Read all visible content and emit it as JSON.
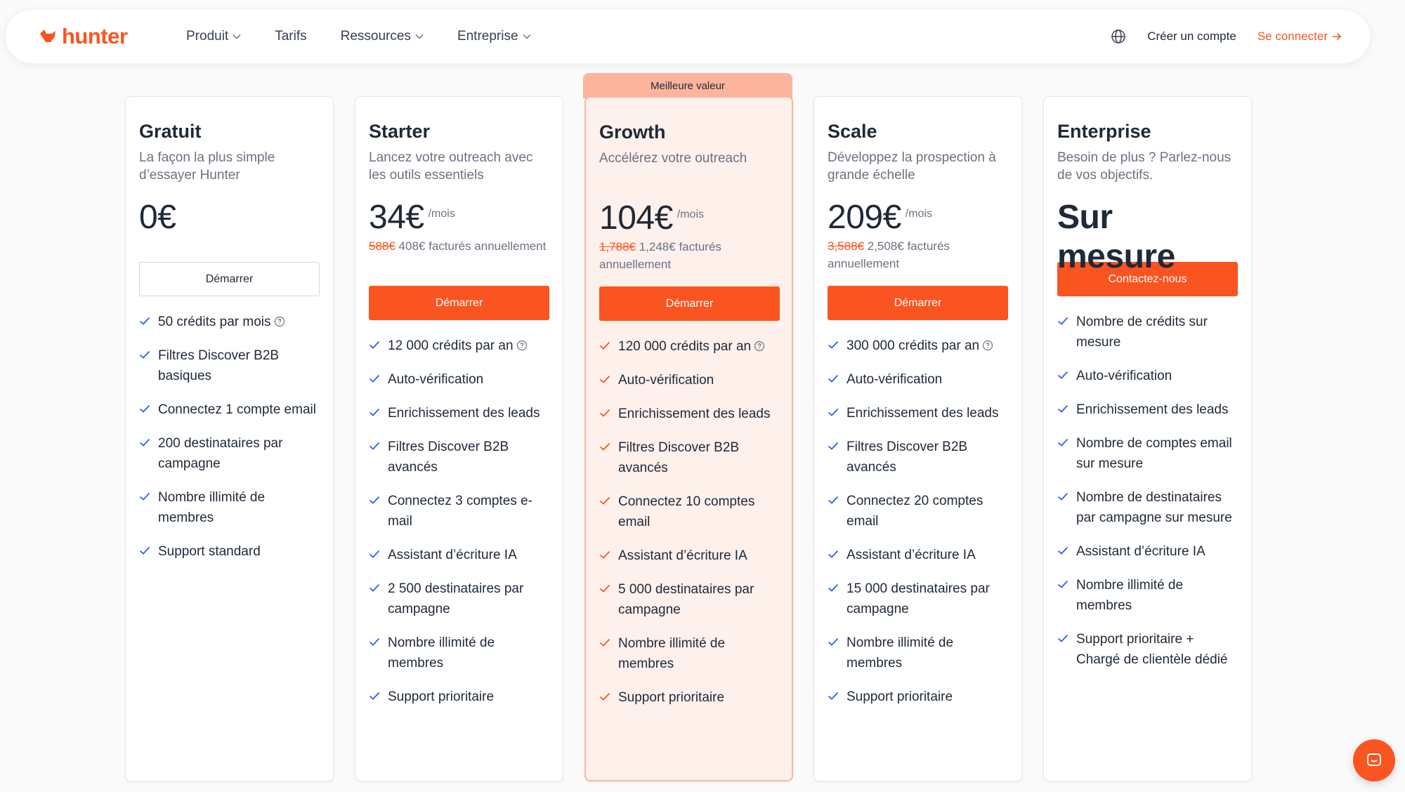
{
  "brand": {
    "name": "hunter",
    "accent": "#fa5420"
  },
  "nav": {
    "items": [
      {
        "label": "Produit",
        "dropdown": true
      },
      {
        "label": "Tarifs",
        "dropdown": false
      },
      {
        "label": "Ressources",
        "dropdown": true
      },
      {
        "label": "Entreprise",
        "dropdown": true
      }
    ],
    "create_account": "Créer un compte",
    "login": "Se connecter"
  },
  "featured_badge": "Meilleure valeur",
  "plans": [
    {
      "name": "Gratuit",
      "description": "La façon la plus simple d’essayer Hunter",
      "price": "0€",
      "per": "",
      "old_price": "",
      "billing": "",
      "button": "Démarrer",
      "button_style": "outline",
      "features": [
        {
          "text": "50 crédits par mois",
          "help": true
        },
        {
          "text": "Filtres Discover B2B basiques"
        },
        {
          "text": "Connectez 1 compte email"
        },
        {
          "text": "200 destinataires par campagne"
        },
        {
          "text": "Nombre illimité de membres"
        },
        {
          "text": "Support standard"
        }
      ]
    },
    {
      "name": "Starter",
      "description": "Lancez votre outreach avec les outils essentiels",
      "price": "34€",
      "per": "/mois",
      "old_price": "588€",
      "billing": " 408€ facturés annuellement",
      "button": "Démarrer",
      "button_style": "solid",
      "features": [
        {
          "text": "12 000 crédits par an",
          "help": true
        },
        {
          "text": "Auto-vérification"
        },
        {
          "text": "Enrichissement des leads"
        },
        {
          "text": "Filtres Discover B2B avancés"
        },
        {
          "text": "Connectez 3 comptes e-mail"
        },
        {
          "text": "Assistant d’écriture IA"
        },
        {
          "text": "2 500 destinataires par campagne"
        },
        {
          "text": "Nombre illimité de membres"
        },
        {
          "text": "Support prioritaire"
        }
      ]
    },
    {
      "name": "Growth",
      "description": "Accélérez votre outreach",
      "price": "104€",
      "per": "/mois",
      "old_price": "1,788€",
      "billing": " 1,248€ facturés annuellement",
      "button": "Démarrer",
      "button_style": "solid",
      "featured": true,
      "features": [
        {
          "text": "120 000 crédits par an",
          "help": true
        },
        {
          "text": "Auto-vérification"
        },
        {
          "text": "Enrichissement des leads"
        },
        {
          "text": "Filtres Discover B2B avancés"
        },
        {
          "text": "Connectez 10 comptes email"
        },
        {
          "text": "Assistant d’écriture IA"
        },
        {
          "text": "5 000 destinataires par campagne"
        },
        {
          "text": "Nombre illimité de membres"
        },
        {
          "text": "Support prioritaire"
        }
      ]
    },
    {
      "name": "Scale",
      "description": "Développez la prospection à grande échelle",
      "price": "209€",
      "per": "/mois",
      "old_price": "3,588€",
      "billing": " 2,508€ facturés annuellement",
      "button": "Démarrer",
      "button_style": "solid",
      "features": [
        {
          "text": "300 000 crédits par an",
          "help": true
        },
        {
          "text": "Auto-vérification"
        },
        {
          "text": "Enrichissement des leads"
        },
        {
          "text": "Filtres Discover B2B avancés"
        },
        {
          "text": "Connectez 20 comptes email"
        },
        {
          "text": "Assistant d’écriture IA"
        },
        {
          "text": "15 000 destinataires par campagne"
        },
        {
          "text": "Nombre illimité de membres"
        },
        {
          "text": "Support prioritaire"
        }
      ]
    },
    {
      "name": "Enterprise",
      "description": "Besoin de plus ? Parlez-nous de vos objectifs.",
      "price": "Sur mesure",
      "per": "",
      "old_price": "",
      "billing": "",
      "button": "Contactez-nous",
      "button_style": "solid",
      "custom": true,
      "features": [
        {
          "text": "Nombre de crédits sur mesure"
        },
        {
          "text": "Auto-vérification"
        },
        {
          "text": "Enrichissement des leads"
        },
        {
          "text": "Nombre de comptes email sur mesure"
        },
        {
          "text": "Nombre de destinataires par campagne sur mesure"
        },
        {
          "text": "Assistant d’écriture IA"
        },
        {
          "text": "Nombre illimité de membres"
        },
        {
          "text": "Support prioritaire + Chargé de clientèle dédié"
        }
      ]
    }
  ]
}
